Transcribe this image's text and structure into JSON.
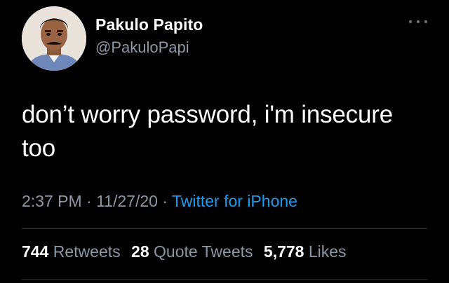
{
  "author": {
    "display_name": "Pakulo Papito",
    "handle": "@PakuloPapi",
    "avatar_icon": "user-avatar"
  },
  "more_icon": "more-horizontal-icon",
  "tweet": {
    "text": "don’t worry password, i'm insecure too",
    "time": "2:37 PM",
    "date": "11/27/20",
    "source": "Twitter for iPhone",
    "separator": " · "
  },
  "stats": {
    "retweets": {
      "count": "744",
      "label": "Retweets"
    },
    "quote_tweets": {
      "count": "28",
      "label": "Quote Tweets"
    },
    "likes": {
      "count": "5,778",
      "label": "Likes"
    }
  },
  "colors": {
    "background": "#000000",
    "text": "#ffffff",
    "secondary_text": "#8b98a5",
    "link": "#1d9bf0",
    "divider": "#2f3336"
  }
}
